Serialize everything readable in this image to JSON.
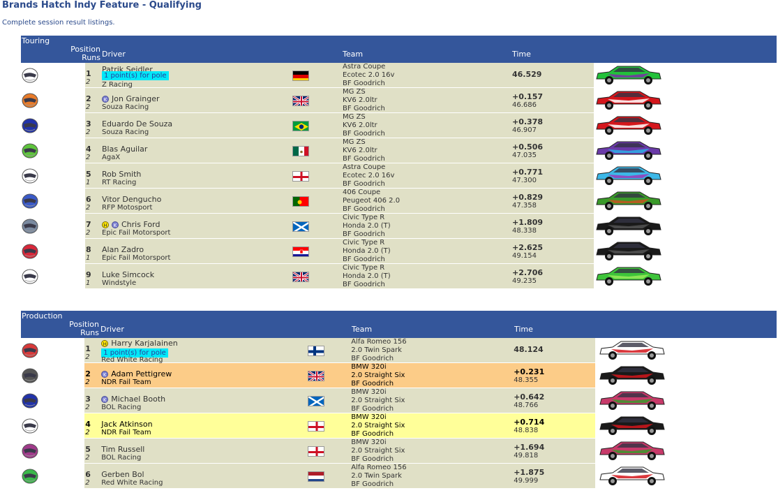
{
  "page": {
    "title": "Brands Hatch Indy Feature - Qualifying",
    "subtitle": "Complete session result listings."
  },
  "headers": {
    "position": "Position",
    "runs": "Runs",
    "driver": "Driver",
    "team": "Team",
    "time": "Time"
  },
  "sections": [
    {
      "name": "Touring",
      "rows": [
        {
          "pos": "1",
          "runs": "2",
          "driver": "Patrik Seidler",
          "badges": [],
          "pole": "1 point(s) for pole",
          "team_name": "Z Racing",
          "flag": "germany",
          "car": "Astra Coupe",
          "engine": "Ecotec 2.0 16v",
          "tyres": "BF Goodrich",
          "time": "46.529",
          "best": "",
          "helmet": "#ffffff",
          "car_color": "#22c13a",
          "car_accent": "#7a2fa8",
          "hl": ""
        },
        {
          "pos": "2",
          "runs": "2",
          "driver": "Jon Grainger",
          "badges": [
            "K"
          ],
          "pole": "",
          "team_name": "Souza Racing",
          "flag": "uk",
          "car": "MG ZS",
          "engine": "KV6 2.0ltr",
          "tyres": "BF Goodrich",
          "time": "+0.157",
          "best": "46.686",
          "helmet": "#e87b2a",
          "car_color": "#d4161c",
          "car_accent": "#ffffff",
          "hl": ""
        },
        {
          "pos": "3",
          "runs": "2",
          "driver": "Eduardo De Souza",
          "badges": [],
          "pole": "",
          "team_name": "Souza Racing",
          "flag": "brazil",
          "car": "MG ZS",
          "engine": "KV6 2.0ltr",
          "tyres": "BF Goodrich",
          "time": "+0.378",
          "best": "46.907",
          "helmet": "#2233aa",
          "car_color": "#d4161c",
          "car_accent": "#ffffff",
          "hl": ""
        },
        {
          "pos": "4",
          "runs": "2",
          "driver": "Blas Aguilar",
          "badges": [],
          "pole": "",
          "team_name": "AgaX",
          "flag": "mexico",
          "car": "MG ZS",
          "engine": "KV6 2.0ltr",
          "tyres": "BF Goodrich",
          "time": "+0.506",
          "best": "47.035",
          "helmet": "#5ec43c",
          "car_color": "#6a3aa8",
          "car_accent": "#2ab0e8",
          "hl": ""
        },
        {
          "pos": "5",
          "runs": "1",
          "driver": "Rob Smith",
          "badges": [],
          "pole": "",
          "team_name": "RT Racing",
          "flag": "england",
          "car": "Astra Coupe",
          "engine": "Ecotec 2.0 16v",
          "tyres": "BF Goodrich",
          "time": "+0.771",
          "best": "47.300",
          "helmet": "#ffffff",
          "car_color": "#3cb8e8",
          "car_accent": "#9a3ab8",
          "hl": ""
        },
        {
          "pos": "6",
          "runs": "2",
          "driver": "Vitor Dengucho",
          "badges": [],
          "pole": "",
          "team_name": "RFP Motosport",
          "flag": "portugal",
          "car": "406 Coupe",
          "engine": "Peugeot 406 2.0",
          "tyres": "BF Goodrich",
          "time": "+0.829",
          "best": "47.358",
          "helmet": "#3a5ac8",
          "car_color": "#3a9a2a",
          "car_accent": "#c8521e",
          "hl": ""
        },
        {
          "pos": "7",
          "runs": "2",
          "driver": "Chris Ford",
          "badges": [
            "H",
            "K"
          ],
          "pole": "",
          "team_name": "Epic Fail Motorsport",
          "flag": "scotland",
          "car": "Civic Type R",
          "engine": "Honda 2.0 (T)",
          "tyres": "BF Goodrich",
          "time": "+1.809",
          "best": "48.338",
          "helmet": "#7a8aa0",
          "car_color": "#1a1a1a",
          "car_accent": "#555555",
          "hl": ""
        },
        {
          "pos": "8",
          "runs": "1",
          "driver": "Alan Zadro",
          "badges": [],
          "pole": "",
          "team_name": "Epic Fail Motorsport",
          "flag": "croatia",
          "car": "Civic Type R",
          "engine": "Honda 2.0 (T)",
          "tyres": "BF Goodrich",
          "time": "+2.625",
          "best": "49.154",
          "helmet": "#d8283a",
          "car_color": "#1a1a1a",
          "car_accent": "#555555",
          "hl": ""
        },
        {
          "pos": "9",
          "runs": "1",
          "driver": "Luke Simcock",
          "badges": [],
          "pole": "",
          "team_name": "Windstyle",
          "flag": "uk",
          "car": "Civic Type R",
          "engine": "Honda 2.0 (T)",
          "tyres": "BF Goodrich",
          "time": "+2.706",
          "best": "49.235",
          "helmet": "#ffffff",
          "car_color": "#3ec43a",
          "car_accent": "#9aea5a",
          "hl": ""
        }
      ]
    },
    {
      "name": "Production",
      "rows": [
        {
          "pos": "1",
          "runs": "2",
          "driver": "Harry Karjalainen",
          "badges": [
            "H"
          ],
          "pole": "1 point(s) for pole",
          "team_name": "Red White Racing",
          "flag": "finland",
          "car": "Alfa Romeo 156",
          "engine": "2.0 Twin Spark",
          "tyres": "BF Goodrich",
          "time": "48.124",
          "best": "",
          "helmet": "#d83a3a",
          "car_color": "#ffffff",
          "car_accent": "#d4161c",
          "hl": ""
        },
        {
          "pos": "2",
          "runs": "2",
          "driver": "Adam Pettigrew",
          "badges": [
            "K"
          ],
          "pole": "",
          "team_name": "NDR Fail Team",
          "flag": "uk",
          "car": "BMW 320i",
          "engine": "2.0 Straight Six",
          "tyres": "BF Goodrich",
          "time": "+0.231",
          "best": "48.355",
          "helmet": "#555555",
          "car_color": "#1a1a1a",
          "car_accent": "#d4161c",
          "hl": "orange"
        },
        {
          "pos": "3",
          "runs": "2",
          "driver": "Michael Booth",
          "badges": [
            "K"
          ],
          "pole": "",
          "team_name": "BOL Racing",
          "flag": "scotland",
          "car": "BMW 320i",
          "engine": "2.0 Straight Six",
          "tyres": "BF Goodrich",
          "time": "+0.642",
          "best": "48.766",
          "helmet": "#2233aa",
          "car_color": "#c83a6a",
          "car_accent": "#3a9a2a",
          "hl": ""
        },
        {
          "pos": "4",
          "runs": "2",
          "driver": "Jack Atkinson",
          "badges": [],
          "pole": "",
          "team_name": "NDR Fail Team",
          "flag": "england",
          "car": "BMW 320i",
          "engine": "2.0 Straight Six",
          "tyres": "BF Goodrich",
          "time": "+0.714",
          "best": "48.838",
          "helmet": "#ffffff",
          "car_color": "#1a1a1a",
          "car_accent": "#d4161c",
          "hl": "yellow"
        },
        {
          "pos": "5",
          "runs": "2",
          "driver": "Tim Russell",
          "badges": [],
          "pole": "",
          "team_name": "BOL Racing",
          "flag": "england",
          "car": "BMW 320i",
          "engine": "2.0 Straight Six",
          "tyres": "BF Goodrich",
          "time": "+1.694",
          "best": "49.818",
          "helmet": "#a03a8a",
          "car_color": "#c83a6a",
          "car_accent": "#3a9a2a",
          "hl": ""
        },
        {
          "pos": "6",
          "runs": "2",
          "driver": "Gerben Bol",
          "badges": [],
          "pole": "",
          "team_name": "Red White Racing",
          "flag": "netherlands",
          "car": "Alfa Romeo 156",
          "engine": "2.0 Twin Spark",
          "tyres": "BF Goodrich",
          "time": "+1.875",
          "best": "49.999",
          "helmet": "#3ab84a",
          "car_color": "#ffffff",
          "car_accent": "#d4161c",
          "hl": ""
        }
      ]
    }
  ]
}
